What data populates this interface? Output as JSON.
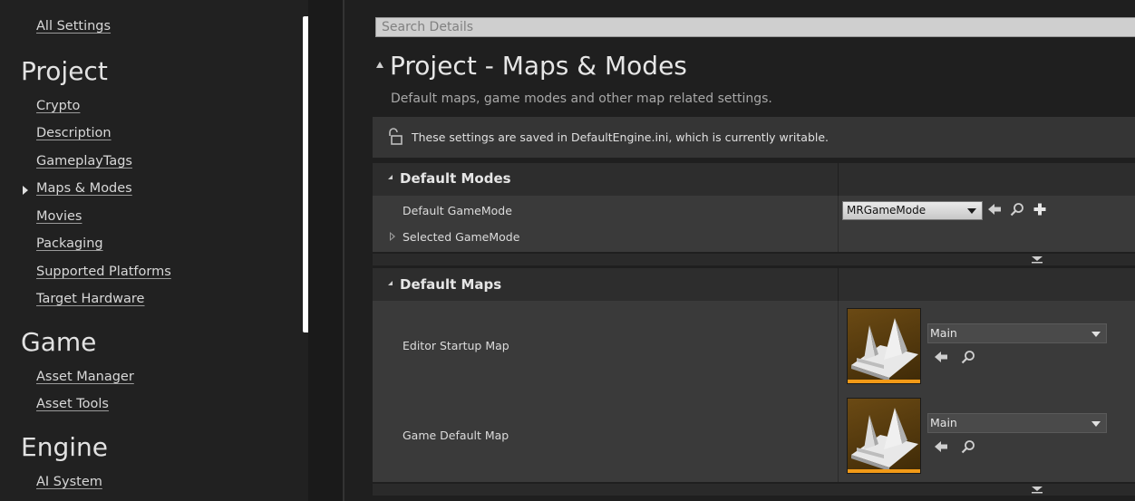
{
  "sidebar": {
    "all_settings": "All Settings",
    "project_heading": "Project",
    "project_items": [
      "Crypto",
      "Description",
      "GameplayTags",
      "Maps & Modes",
      "Movies",
      "Packaging",
      "Supported Platforms",
      "Target Hardware"
    ],
    "game_heading": "Game",
    "game_items": [
      "Asset Manager",
      "Asset Tools"
    ],
    "engine_heading": "Engine",
    "engine_items": [
      "AI System"
    ]
  },
  "search": {
    "placeholder": "Search Details"
  },
  "page": {
    "title": "Project - Maps & Modes",
    "subtitle": "Default maps, game modes and other map related settings.",
    "info": "These settings are saved in DefaultEngine.ini, which is currently writable."
  },
  "default_modes": {
    "title": "Default Modes",
    "default_gamemode_label": "Default GameMode",
    "default_gamemode_value": "MRGameMode",
    "selected_gamemode_label": "Selected GameMode"
  },
  "default_maps": {
    "title": "Default Maps",
    "editor_startup_label": "Editor Startup Map",
    "editor_startup_value": "Main",
    "game_default_label": "Game Default Map",
    "game_default_value": "Main"
  },
  "colors": {
    "accent_orange": "#f29a17",
    "panel_bg": "#1f1f1f",
    "row_bg": "#3a3a3a",
    "header_bg": "#2d2d2d"
  },
  "icons": [
    "unlock-icon",
    "use-selected-arrow-icon",
    "browse-magnifier-icon",
    "add-plus-icon",
    "expand-arrow-icon",
    "map-thumbnail-icon"
  ]
}
